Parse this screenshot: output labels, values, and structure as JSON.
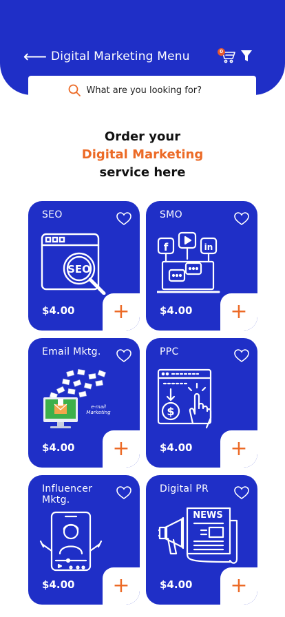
{
  "header": {
    "title": "Digital Marketing Menu",
    "cart_count": "0"
  },
  "search": {
    "placeholder": "What are you looking for?"
  },
  "heading": {
    "line1": "Order your",
    "line2": "Digital Marketing",
    "line3": "service here"
  },
  "colors": {
    "primary": "#1f2fc7",
    "accent": "#ec6a26",
    "badge": "#e4572e"
  },
  "services": [
    {
      "name": "SEO",
      "price": "$4.00",
      "icon": "seo-magnifier-icon"
    },
    {
      "name": "SMO",
      "price": "$4.00",
      "icon": "social-media-laptop-icon"
    },
    {
      "name": "Email Mktg.",
      "price": "$4.00",
      "icon": "email-marketing-icon",
      "image_text": "e-mail Marketing"
    },
    {
      "name": "PPC",
      "price": "$4.00",
      "icon": "ppc-click-icon"
    },
    {
      "name": "Influencer Mktg.",
      "price": "$4.00",
      "icon": "influencer-video-icon"
    },
    {
      "name": "Digital PR",
      "price": "$4.00",
      "icon": "news-megaphone-icon",
      "image_text": "NEWS"
    }
  ]
}
